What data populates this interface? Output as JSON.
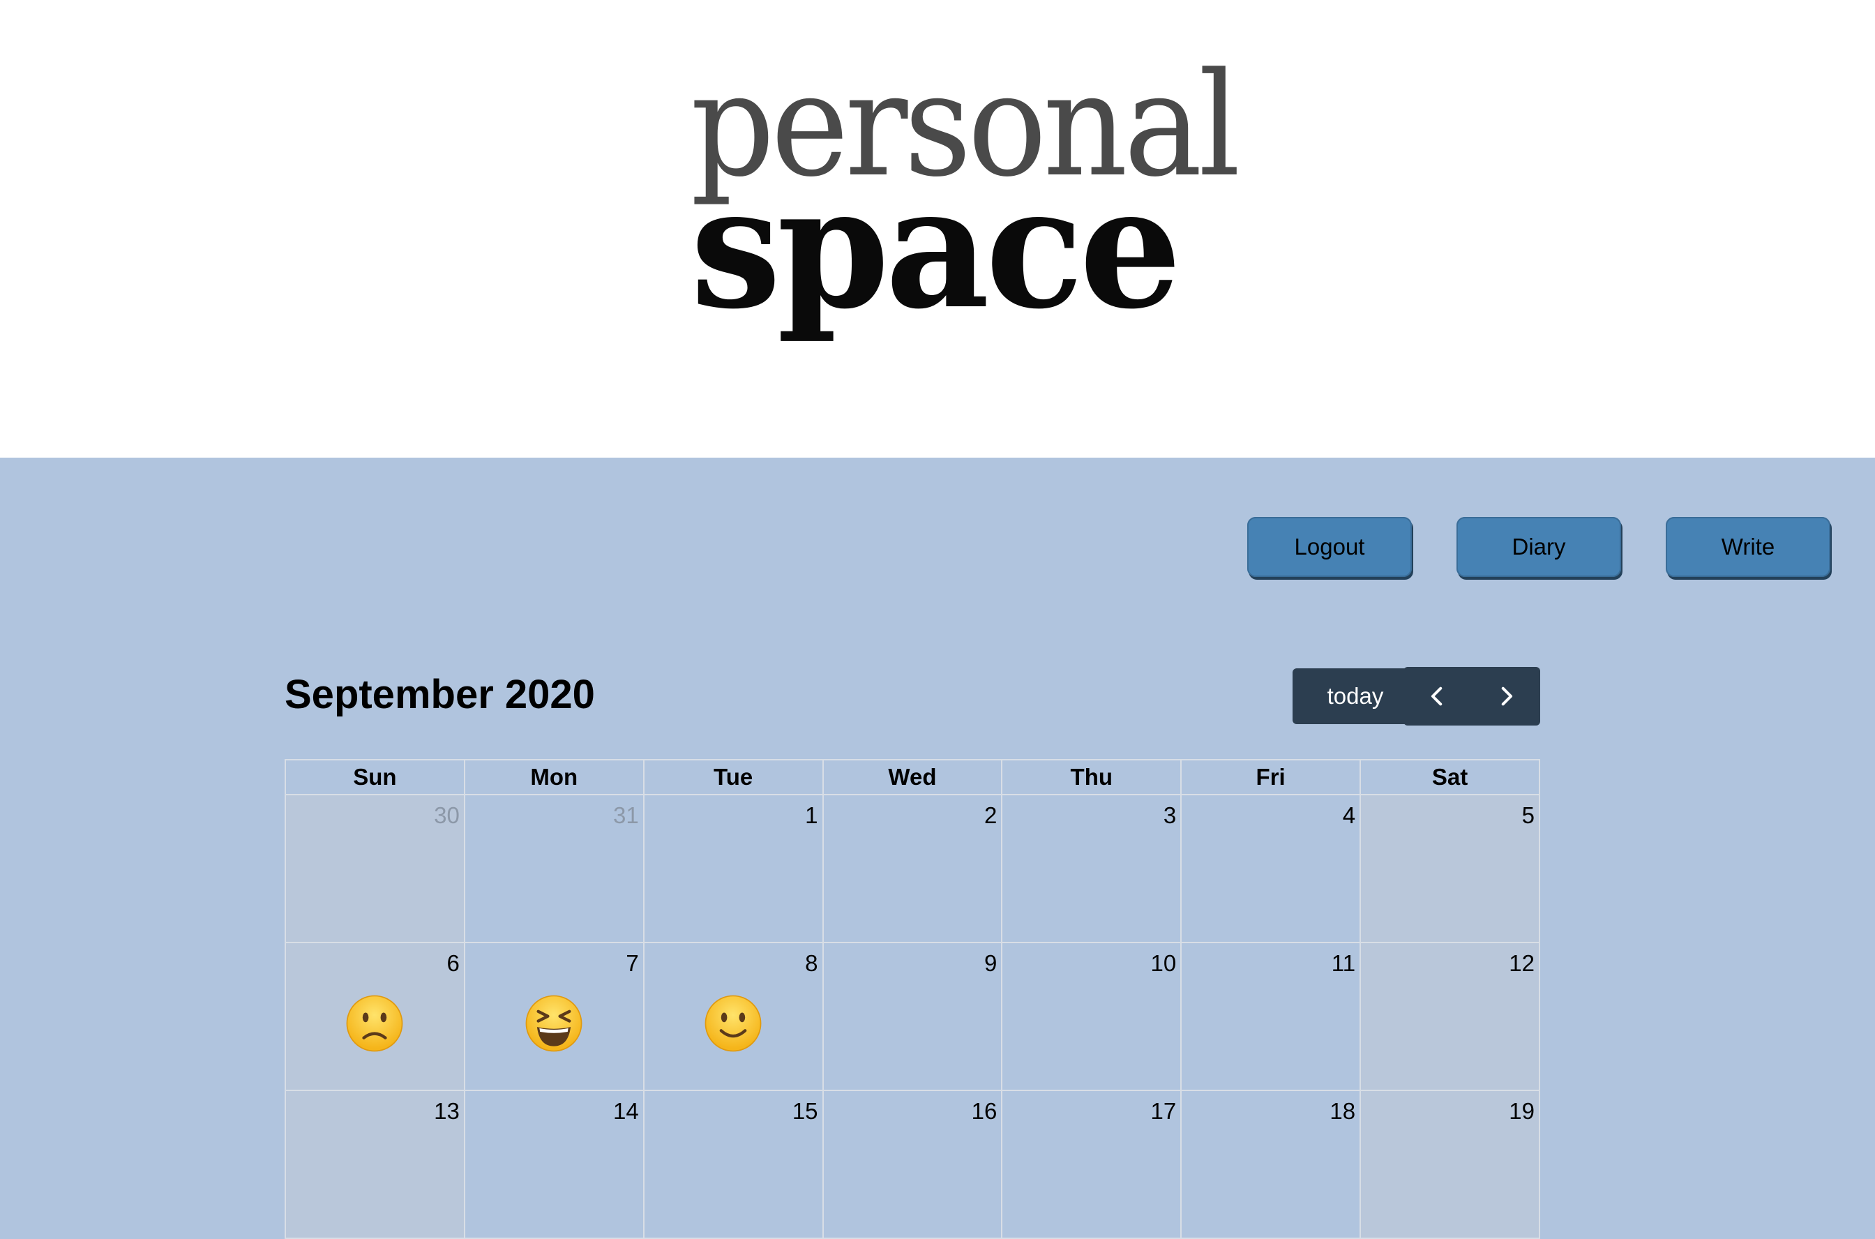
{
  "logo": {
    "line1": "personal",
    "line2": "space"
  },
  "nav": {
    "logout": "Logout",
    "diary": "Diary",
    "write": "Write"
  },
  "calendar": {
    "title": "September 2020",
    "today_label": "today",
    "prev_icon": "chevron-left-icon",
    "next_icon": "chevron-right-icon",
    "weekdays": [
      "Sun",
      "Mon",
      "Tue",
      "Wed",
      "Thu",
      "Fri",
      "Sat"
    ],
    "weeks": [
      [
        {
          "day": "30",
          "other_month": true
        },
        {
          "day": "31",
          "other_month": true
        },
        {
          "day": "1"
        },
        {
          "day": "2"
        },
        {
          "day": "3"
        },
        {
          "day": "4"
        },
        {
          "day": "5"
        }
      ],
      [
        {
          "day": "6",
          "mood": "slightly-frowning-face-icon"
        },
        {
          "day": "7",
          "mood": "grinning-squinting-face-icon"
        },
        {
          "day": "8",
          "mood": "slightly-smiling-face-icon"
        },
        {
          "day": "9"
        },
        {
          "day": "10"
        },
        {
          "day": "11"
        },
        {
          "day": "12"
        }
      ],
      [
        {
          "day": "13"
        },
        {
          "day": "14"
        },
        {
          "day": "15"
        },
        {
          "day": "16"
        },
        {
          "day": "17"
        },
        {
          "day": "18"
        },
        {
          "day": "19"
        }
      ]
    ]
  },
  "colors": {
    "header_bg": "#ffffff",
    "page_bg": "#b0c4de",
    "nav_button": "#4682b4",
    "calendar_button": "#2c3e50",
    "weekend_cell": "#b9c7da"
  }
}
